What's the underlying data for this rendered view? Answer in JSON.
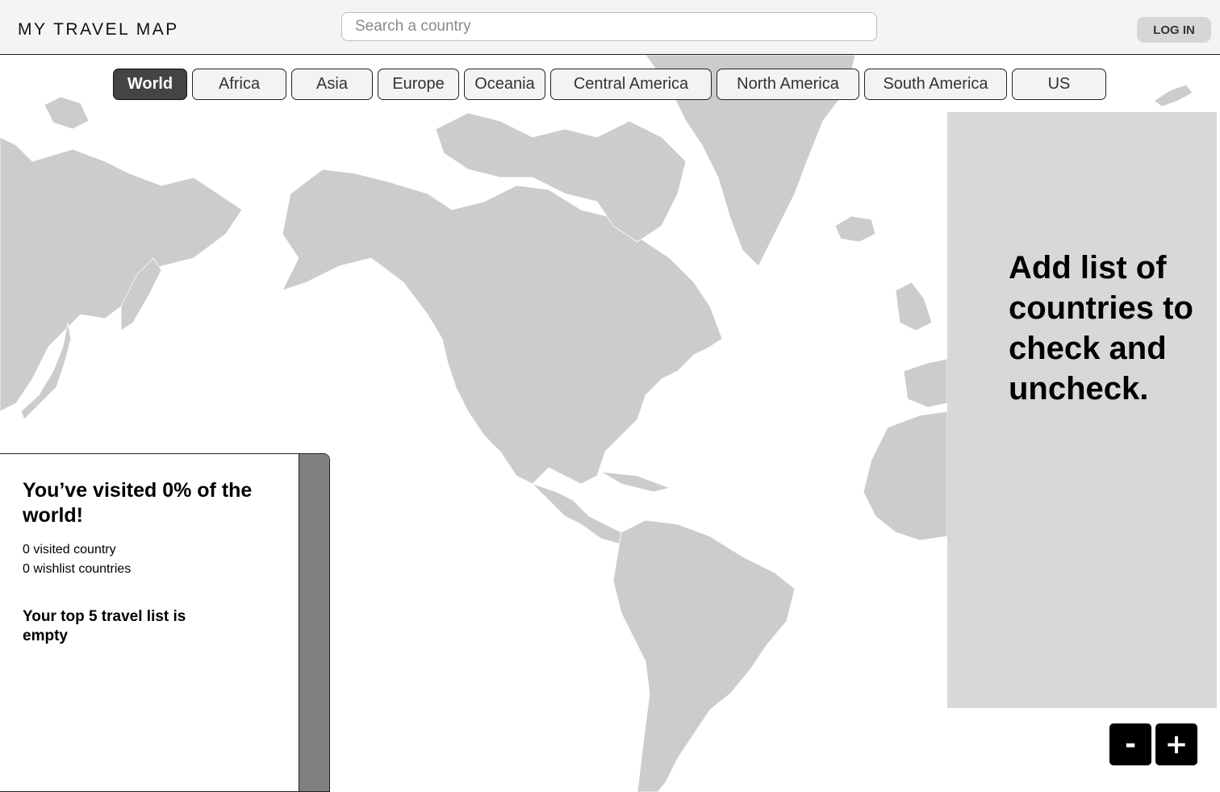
{
  "header": {
    "brand": "MY TRAVEL MAP",
    "search_placeholder": "Search a country",
    "login_label": "LOG IN"
  },
  "tabs": [
    {
      "label": "World",
      "active": true
    },
    {
      "label": "Africa"
    },
    {
      "label": "Asia"
    },
    {
      "label": "Europe"
    },
    {
      "label": "Oceania"
    },
    {
      "label": "Central America"
    },
    {
      "label": "North America"
    },
    {
      "label": "South America"
    },
    {
      "label": "US"
    }
  ],
  "right_panel": {
    "note": "Add list of countries to check and uncheck."
  },
  "stats": {
    "headline": "You’ve visited 0% of the world!",
    "visited": "0 visited country",
    "wishlist": "0 wishlist countries",
    "top5": "Your top 5 travel list is empty"
  },
  "zoom": {
    "out_label": "-",
    "in_label": "+"
  },
  "colors": {
    "land": "#cccccc",
    "active_tab": "#444444",
    "panel": "#d8d8d8",
    "sidebar_bar": "#808080"
  }
}
